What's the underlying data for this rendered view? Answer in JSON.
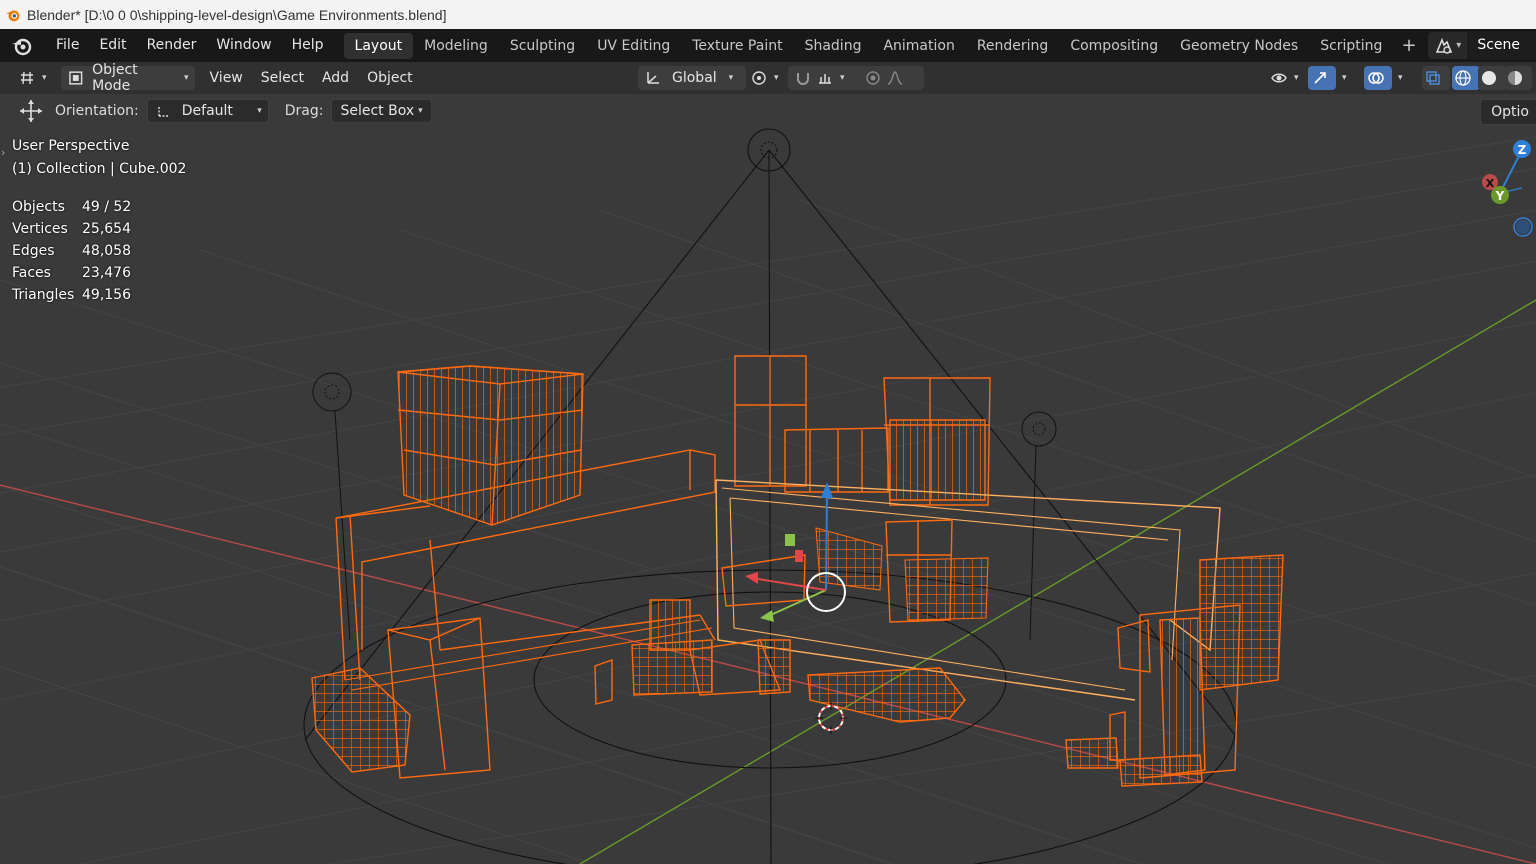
{
  "window": {
    "title": "Blender* [D:\\0 0 0\\shipping-level-design\\Game Environments.blend]"
  },
  "menu": {
    "items": [
      "File",
      "Edit",
      "Render",
      "Window",
      "Help"
    ]
  },
  "workspaces": {
    "tabs": [
      "Layout",
      "Modeling",
      "Sculpting",
      "UV Editing",
      "Texture Paint",
      "Shading",
      "Animation",
      "Rendering",
      "Compositing",
      "Geometry Nodes",
      "Scripting"
    ],
    "active": "Layout",
    "add": "+"
  },
  "scene": {
    "name": "Scene"
  },
  "viewport_header": {
    "mode": "Object Mode",
    "menus": [
      "View",
      "Select",
      "Add",
      "Object"
    ],
    "transform_orientation": "Global"
  },
  "tool_options": {
    "orientation_label": "Orientation:",
    "orientation_value": "Default",
    "drag_label": "Drag:",
    "drag_value": "Select Box",
    "options_label": "Optio"
  },
  "overlay": {
    "view_name": "User Perspective",
    "context": "(1) Collection | Cube.002",
    "stats": [
      {
        "label": "Objects",
        "value": "49 / 52"
      },
      {
        "label": "Vertices",
        "value": "25,654"
      },
      {
        "label": "Edges",
        "value": "48,058"
      },
      {
        "label": "Faces",
        "value": "23,476"
      },
      {
        "label": "Triangles",
        "value": "49,156"
      }
    ]
  },
  "gizmo": {
    "axes": [
      "Z",
      "X",
      "Y"
    ]
  },
  "colors": {
    "selected_wire": "#ff6a10",
    "active_wire": "#ffb060",
    "x_axis": "#b94a4a",
    "y_axis": "#6a9a2a",
    "z_axis": "#2e7fd6",
    "grid": "#444444"
  }
}
